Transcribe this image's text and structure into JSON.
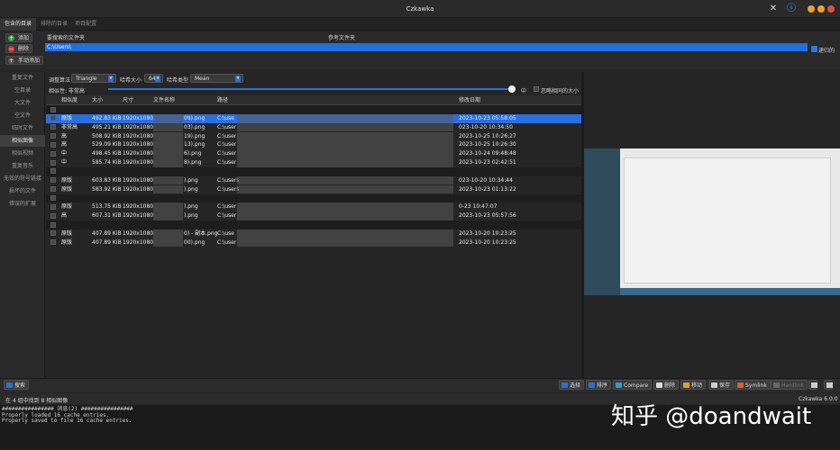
{
  "window": {
    "title": "Czkawka"
  },
  "tabs": [
    "包含的目录",
    "排除的目录",
    "项目配置"
  ],
  "dirs": {
    "buttons": {
      "add": "添加",
      "remove": "删除",
      "manual_add": "手动添加"
    },
    "col_search": "要搜索的文件夹",
    "col_reference": "参考文件夹",
    "path": "C:\\Users\\",
    "recursive": "递归的"
  },
  "sidebar": [
    "重复文件",
    "空目录",
    "大文件",
    "空文件",
    "临时文件",
    "相似图像",
    "相似视频",
    "重复音乐",
    "无效的符号链接",
    "损坏的文件",
    "错误的扩展"
  ],
  "settings": {
    "algo_label": "调整算法",
    "algo_value": "Triangle",
    "hash_size_label": "哈希大小",
    "hash_size_value": "64",
    "hash_type_label": "哈希类型",
    "hash_type_value": "Mean",
    "similarity_label": "相似性: 非常高",
    "similarity_level": "中",
    "ignore_same_size": "忽略相同的大小"
  },
  "table": {
    "headers": [
      "相似度",
      "大小",
      "尺寸",
      "文件名称",
      "路径",
      "修改日期"
    ],
    "rows": [
      {
        "type": "header"
      },
      {
        "type": "item",
        "selected": true,
        "sim": "原版",
        "size": "492.83 KiB",
        "dim": "1920x1080",
        "name": "09).png",
        "path": "C:\\use",
        "date": "2023-10-23 05:58:05"
      },
      {
        "type": "item",
        "sim": "非常高",
        "size": "495.21 KiB",
        "dim": "1920x1080",
        "name": "03).png",
        "path": "C:\\user",
        "date": "023-10-20 10:34:50"
      },
      {
        "type": "item",
        "sim": "高",
        "size": "508.92 KiB",
        "dim": "1920x1080",
        "name": "19).png",
        "path": "C:\\user",
        "date": "2023-10-25 10:26:27"
      },
      {
        "type": "item",
        "sim": "高",
        "size": "529.09 KiB",
        "dim": "1920x1080",
        "name": "13).png",
        "path": "C:\\user",
        "date": "2023-10-25 10:26:30"
      },
      {
        "type": "item",
        "sim": "中",
        "size": "498.45 KiB",
        "dim": "1920x1080",
        "name": "6).png",
        "path": "C:\\user",
        "date": "2023-10-24 09:48:48"
      },
      {
        "type": "item",
        "sim": "中",
        "size": "585.74 KiB",
        "dim": "1920x1080",
        "name": "8).png",
        "path": "C:\\user",
        "date": "2023-10-23 02:42:51"
      },
      {
        "type": "header"
      },
      {
        "type": "item",
        "sim": "原版",
        "size": "603.83 KiB",
        "dim": "1920x1080",
        "name": ").png",
        "path": "C:\\users",
        "date": "023-10-20 10:34:44"
      },
      {
        "type": "item",
        "sim": "原版",
        "size": "583.92 KiB",
        "dim": "1920x1080",
        "name": ").png",
        "path": "C:\\users",
        "date": "2023-10-23 01:13:22"
      },
      {
        "type": "header"
      },
      {
        "type": "item",
        "sim": "原版",
        "size": "513.75 KiB",
        "dim": "1920x1080",
        "name": ").png",
        "path": "C:\\user",
        "date": "0-23 10:47:07"
      },
      {
        "type": "item",
        "sim": "高",
        "size": "607.31 KiB",
        "dim": "1920x1080",
        "name": ").png",
        "path": "C:\\user",
        "date": "2023-10-23 05:57:56"
      },
      {
        "type": "header"
      },
      {
        "type": "item",
        "sim": "原版",
        "size": "407.89 KiB",
        "dim": "1920x1080",
        "name": "0) - 副本.png",
        "path": "C:\\use",
        "date": "2023-10-20 10:23:25"
      },
      {
        "type": "item",
        "sim": "原版",
        "size": "407.89 KiB",
        "dim": "1920x1080",
        "name": "00).png",
        "path": "C:\\user",
        "date": "2023-10-20 10:23:25"
      }
    ]
  },
  "toolbar": {
    "search": "搜索",
    "select": "选择",
    "sort": "排序",
    "compare": "Compare",
    "delete": "删除",
    "move": "移动",
    "save": "保存",
    "symlink": "Symlink",
    "hardlink": "Hardlink"
  },
  "status": {
    "left": "在 4 组中找到 8 相似图像",
    "version": "Czkawka 6.0.0"
  },
  "log": [
    "################ 消息(2) ################",
    "Properly loaded 16 cache entries.",
    "Properly saved to file 16 cache entries."
  ],
  "watermark": "知乎 @doandwait"
}
